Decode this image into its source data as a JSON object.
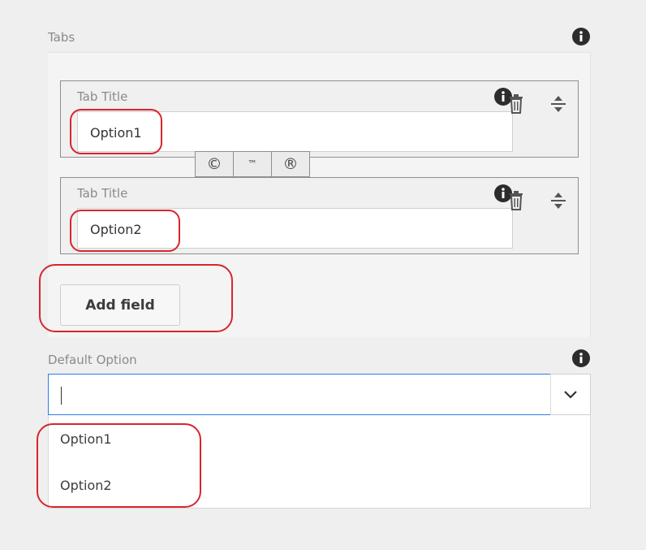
{
  "tabs_field": {
    "label": "Tabs",
    "items": [
      {
        "title_label": "Tab Title",
        "value": "Option1"
      },
      {
        "title_label": "Tab Title",
        "value": "Option2"
      }
    ],
    "symbols": [
      "©",
      "™",
      "®"
    ],
    "add_button_label": "Add field"
  },
  "default_option": {
    "label": "Default Option",
    "value": "",
    "options": [
      "Option1",
      "Option2"
    ]
  },
  "icons": {
    "info": "info-icon",
    "delete": "trash-icon",
    "reorder": "drag-handle-icon",
    "dropdown": "chevron-down-icon"
  },
  "colors": {
    "annotation": "#d7262c",
    "focus_border": "#2680eb",
    "background": "#efefef"
  }
}
